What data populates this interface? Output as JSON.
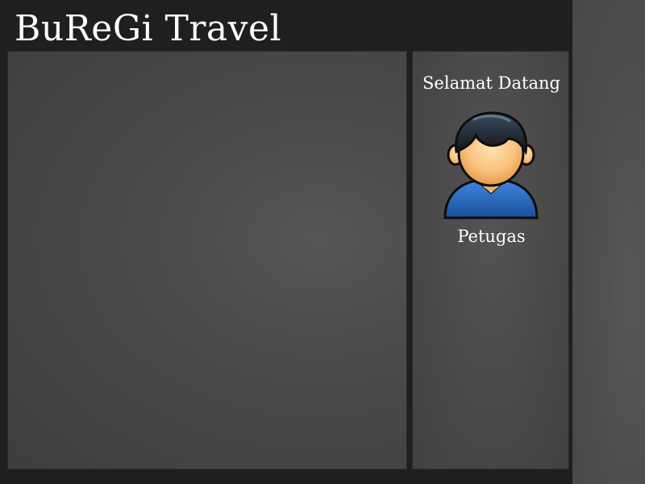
{
  "app": {
    "title": "BuReGi Travel"
  },
  "sidebar": {
    "greeting": "Selamat Datang",
    "user_role": "Petugas",
    "avatar_icon": "user-avatar-icon"
  },
  "colors": {
    "header_background": "#1f1f1f",
    "panel_background": "#4a4949",
    "text": "#ffffff",
    "avatar_shirt": "#1f5db0",
    "avatar_skin": "#f7c27a",
    "avatar_hair": "#1c2530"
  }
}
